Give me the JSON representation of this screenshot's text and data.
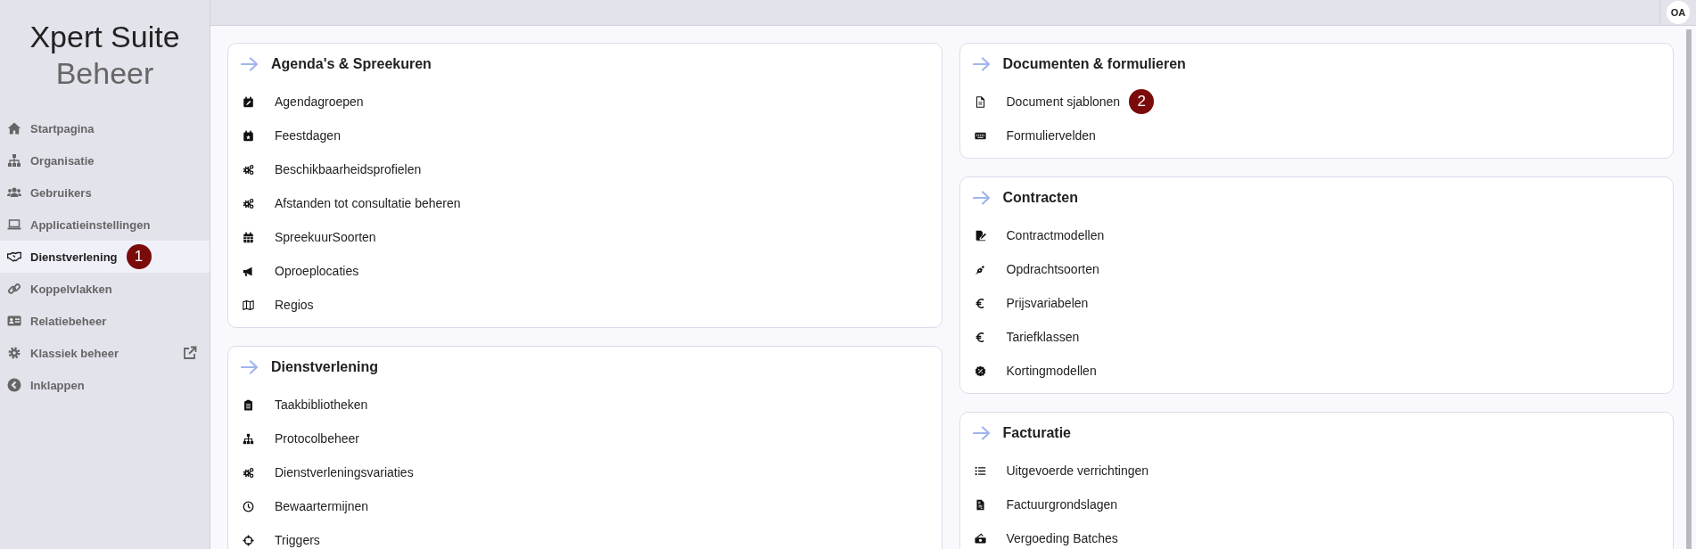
{
  "sidebar": {
    "title": "Xpert Suite",
    "subtitle": "Beheer",
    "items": [
      {
        "label": "Startpagina",
        "kind": "home",
        "selected": false
      },
      {
        "label": "Organisatie",
        "kind": "sitemap",
        "selected": false
      },
      {
        "label": "Gebruikers",
        "kind": "users",
        "selected": false
      },
      {
        "label": "Applicatieinstellingen",
        "kind": "laptop",
        "selected": false
      },
      {
        "label": "Dienstverlening",
        "kind": "handshake",
        "selected": true,
        "badge": "1"
      },
      {
        "label": "Koppelvlakken",
        "kind": "link",
        "selected": false
      },
      {
        "label": "Relatiebeheer",
        "kind": "idcard",
        "selected": false
      },
      {
        "label": "Klassiek beheer",
        "kind": "cog",
        "selected": false,
        "external": true
      },
      {
        "label": "Inklappen",
        "kind": "chevron",
        "selected": false
      }
    ]
  },
  "user": {
    "initials": "OA"
  },
  "columns": [
    [
      {
        "title": "Agenda's & Spreekuren",
        "items": [
          {
            "label": "Agendagroepen",
            "kind": "calendar-edit"
          },
          {
            "label": "Feestdagen",
            "kind": "calendar-star"
          },
          {
            "label": "Beschikbaarheidsprofielen",
            "kind": "cogs"
          },
          {
            "label": "Afstanden tot consultatie beheren",
            "kind": "cogs"
          },
          {
            "label": "SpreekuurSoorten",
            "kind": "calendar"
          },
          {
            "label": "Oproeplocaties",
            "kind": "bullhorn"
          },
          {
            "label": "Regios",
            "kind": "map"
          }
        ]
      },
      {
        "title": "Dienstverlening",
        "items": [
          {
            "label": "Taakbibliotheken",
            "kind": "clipboard"
          },
          {
            "label": "Protocolbeheer",
            "kind": "sitemap"
          },
          {
            "label": "Dienstverleningsvariaties",
            "kind": "cogs"
          },
          {
            "label": "Bewaartermijnen",
            "kind": "clock"
          },
          {
            "label": "Triggers",
            "kind": "crosshairs"
          }
        ]
      }
    ],
    [
      {
        "title": "Documenten & formulieren",
        "items": [
          {
            "label": "Document sjablonen",
            "kind": "file",
            "badge": "2"
          },
          {
            "label": "Formuliervelden",
            "kind": "keyboard"
          }
        ]
      },
      {
        "title": "Contracten",
        "items": [
          {
            "label": "Contractmodellen",
            "kind": "signature"
          },
          {
            "label": "Opdrachtsoorten",
            "kind": "pen"
          },
          {
            "label": "Prijsvariabelen",
            "kind": "euro"
          },
          {
            "label": "Tariefklassen",
            "kind": "euro"
          },
          {
            "label": "Kortingmodellen",
            "kind": "percent"
          }
        ]
      },
      {
        "title": "Facturatie",
        "items": [
          {
            "label": "Uitgevoerde verrichtingen",
            "kind": "list"
          },
          {
            "label": "Factuurgrondslagen",
            "kind": "invoice"
          },
          {
            "label": "Vergoeding Batches",
            "kind": "money"
          }
        ]
      }
    ]
  ]
}
